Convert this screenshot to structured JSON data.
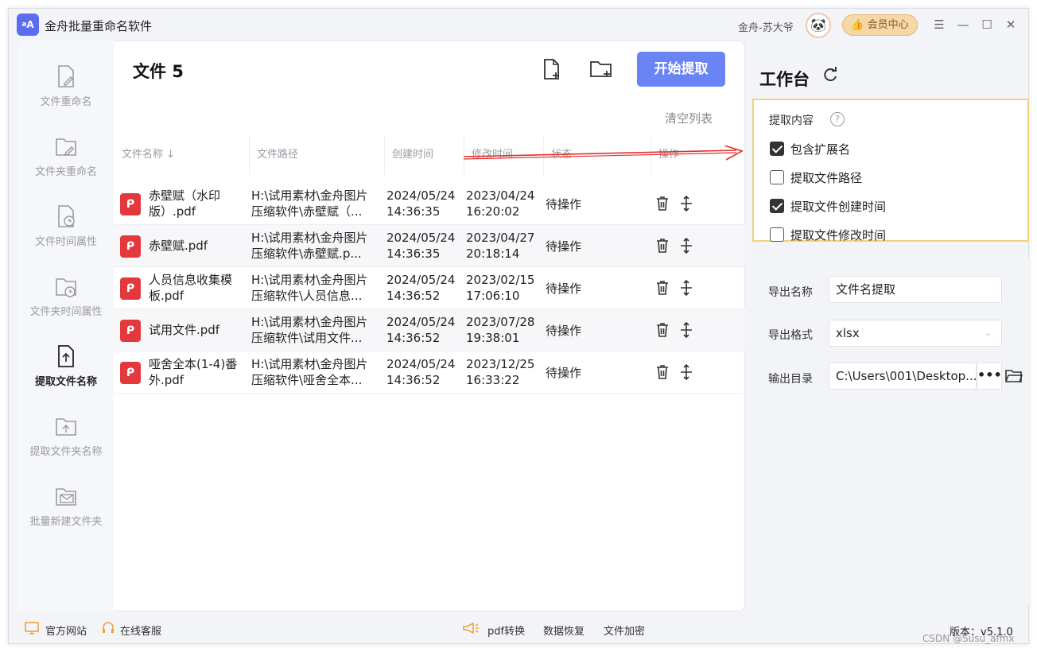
{
  "app": {
    "title": "金舟批量重命名软件",
    "logo_text": "A",
    "logo_small": "a",
    "username": "金舟-苏大爷",
    "member_label": "会员中心"
  },
  "sidebar": {
    "items": [
      {
        "label": "文件重命名",
        "icon": "file-edit-icon"
      },
      {
        "label": "文件夹重命名",
        "icon": "folder-edit-icon"
      },
      {
        "label": "文件时间属性",
        "icon": "file-clock-icon"
      },
      {
        "label": "文件夹时间属性",
        "icon": "folder-clock-icon"
      },
      {
        "label": "提取文件名称",
        "icon": "file-upload-icon",
        "active": true
      },
      {
        "label": "提取文件夹名称",
        "icon": "folder-upload-icon"
      },
      {
        "label": "批量新建文件夹",
        "icon": "folder-mail-icon"
      }
    ]
  },
  "main": {
    "title": "文件 5",
    "start_button": "开始提取",
    "clear_list": "清空列表",
    "columns": [
      "文件名称",
      "文件路径",
      "创建时间",
      "修改时间",
      "状态",
      "操作"
    ],
    "rows": [
      {
        "name": "赤壁赋（水印版）.pdf",
        "path": "H:\\试用素材\\金舟图片压缩软件\\赤壁赋（...",
        "created_date": "2024/05/24",
        "created_time": "14:36:35",
        "modified_date": "2023/04/24",
        "modified_time": "16:20:02",
        "status": "待操作"
      },
      {
        "name": "赤壁赋.pdf",
        "path": "H:\\试用素材\\金舟图片压缩软件\\赤壁赋.p...",
        "created_date": "2024/05/24",
        "created_time": "14:36:35",
        "modified_date": "2023/04/27",
        "modified_time": "20:18:14",
        "status": "待操作"
      },
      {
        "name": "人员信息收集模板.pdf",
        "path": "H:\\试用素材\\金舟图片压缩软件\\人员信息...",
        "created_date": "2024/05/24",
        "created_time": "14:36:52",
        "modified_date": "2023/02/15",
        "modified_time": "17:06:10",
        "status": "待操作"
      },
      {
        "name": "试用文件.pdf",
        "path": "H:\\试用素材\\金舟图片压缩软件\\试用文件...",
        "created_date": "2024/05/24",
        "created_time": "14:36:52",
        "modified_date": "2023/07/28",
        "modified_time": "19:38:01",
        "status": "待操作"
      },
      {
        "name": "哑舍全本(1-4)番外.pdf",
        "path": "H:\\试用素材\\金舟图片压缩软件\\哑舍全本...",
        "created_date": "2024/05/24",
        "created_time": "14:36:52",
        "modified_date": "2023/12/25",
        "modified_time": "16:33:22",
        "status": "待操作"
      }
    ]
  },
  "workbench": {
    "title": "工作台",
    "extract_title": "提取内容",
    "help_symbol": "?",
    "options": [
      {
        "label": "包含扩展名",
        "checked": true
      },
      {
        "label": "提取文件路径",
        "checked": false
      },
      {
        "label": "提取文件创建时间",
        "checked": true
      },
      {
        "label": "提取文件修改时间",
        "checked": false
      }
    ],
    "export_name_label": "导出名称",
    "export_name_value": "文件名提取",
    "export_format_label": "导出格式",
    "export_format_value": "xlsx",
    "output_dir_label": "输出目录",
    "output_dir_value": "C:\\Users\\001\\Desktop...",
    "more_symbol": "•••"
  },
  "footer": {
    "website": "官方网站",
    "support": "在线客服",
    "pdf": "pdf转换",
    "recovery": "数据恢复",
    "encrypt": "文件加密",
    "version": "版本：v5.1.0",
    "watermark": "CSDN @Susu_afmx"
  },
  "colors": {
    "accent": "#6a83f5",
    "pdf_red": "#e4393c",
    "member_gold": "#f6d7a8",
    "highlight_border": "#f0d27a",
    "annotation_red": "#e0312f"
  }
}
